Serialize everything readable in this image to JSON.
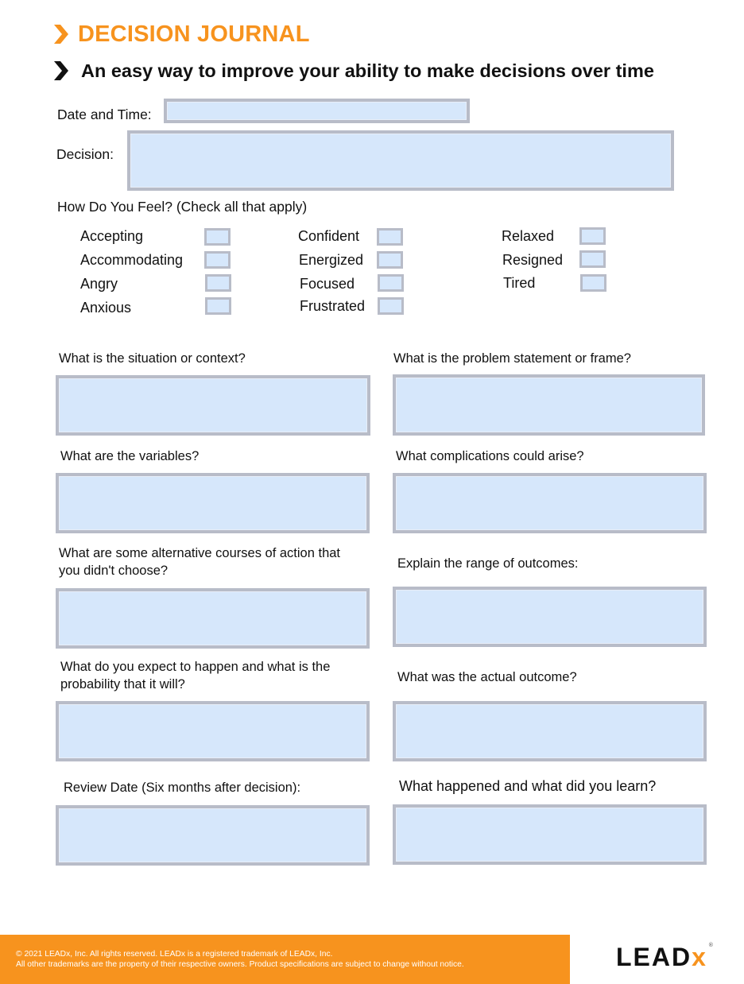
{
  "header": {
    "title": "DECISION JOURNAL",
    "subtitle": "An easy way to improve your ability to make decisions over time",
    "accent_color": "#F7931E"
  },
  "date_time": {
    "label": "Date and Time:",
    "value": ""
  },
  "decision": {
    "label": "Decision:",
    "value": ""
  },
  "feelings": {
    "label": "How Do You Feel? (Check all that apply)",
    "options": [
      {
        "label": "Accepting",
        "checked": false
      },
      {
        "label": "Accommodating",
        "checked": false
      },
      {
        "label": "Angry",
        "checked": false
      },
      {
        "label": "Anxious",
        "checked": false
      },
      {
        "label": "Confident",
        "checked": false
      },
      {
        "label": "Energized",
        "checked": false
      },
      {
        "label": "Focused",
        "checked": false
      },
      {
        "label": "Frustrated",
        "checked": false
      },
      {
        "label": "Relaxed",
        "checked": false
      },
      {
        "label": "Resigned",
        "checked": false
      },
      {
        "label": "Tired",
        "checked": false
      }
    ]
  },
  "questions": [
    {
      "label": "What is the situation or context?",
      "value": ""
    },
    {
      "label": "What is the problem statement or frame?",
      "value": ""
    },
    {
      "label": "What are the variables?",
      "value": ""
    },
    {
      "label": "What complications could arise?",
      "value": ""
    },
    {
      "label": "What are some alternative courses of action that you didn't choose?",
      "value": ""
    },
    {
      "label": "Explain the range of outcomes:",
      "value": ""
    },
    {
      "label": "What do you expect to happen and what is the probability that it will?",
      "value": ""
    },
    {
      "label": "What was the actual outcome?",
      "value": ""
    },
    {
      "label": "Review Date (Six months after decision):",
      "value": ""
    },
    {
      "label": "What happened and what did you learn?",
      "value": ""
    }
  ],
  "footer": {
    "line1": "© 2021 LEADx, Inc. All rights reserved. LEADx is a registered trademark of LEADx, Inc.",
    "line2": "All other trademarks are the property of their respective owners. Product specifications are subject to change without notice.",
    "logo_main": "LEAD",
    "logo_accent": "x",
    "logo_reg": "®"
  }
}
